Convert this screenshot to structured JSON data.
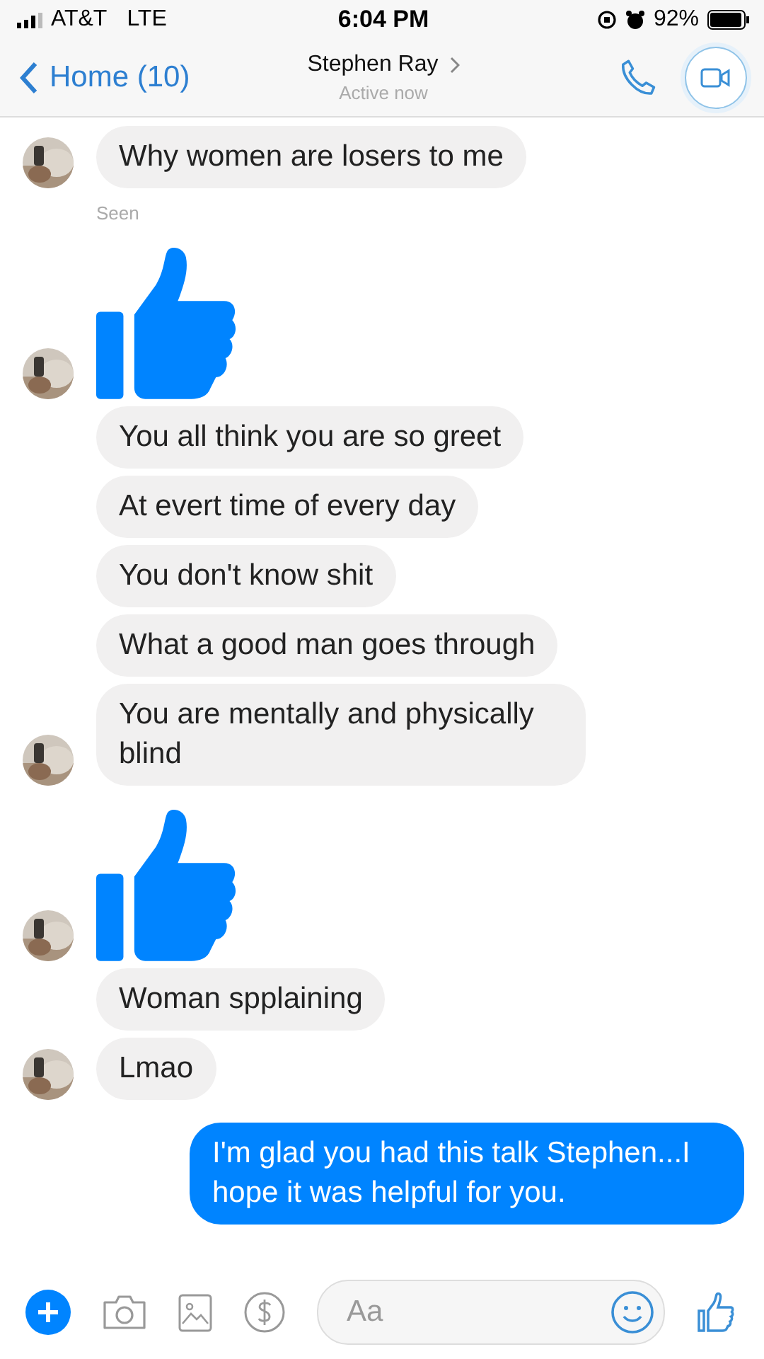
{
  "status_bar": {
    "carrier": "AT&T",
    "network": "LTE",
    "time": "6:04 PM",
    "battery": "92%"
  },
  "header": {
    "back_label": "Home (10)",
    "contact_name": "Stephen Ray",
    "presence": "Active now"
  },
  "messages": [
    {
      "kind": "received",
      "text": "Why women are losers to me",
      "avatar": true
    },
    {
      "kind": "seen",
      "text": "Seen"
    },
    {
      "kind": "like",
      "avatar": true
    },
    {
      "kind": "received",
      "text": "You all think you are so greet",
      "avatar": false
    },
    {
      "kind": "received",
      "text": "At evert time of every day",
      "avatar": false
    },
    {
      "kind": "received",
      "text": "You don't know shit",
      "avatar": false
    },
    {
      "kind": "received",
      "text": "What a good man goes through",
      "avatar": false
    },
    {
      "kind": "received",
      "text": "You are mentally and physically blind",
      "avatar": true
    },
    {
      "kind": "like",
      "avatar": true
    },
    {
      "kind": "received",
      "text": "Woman spplaining",
      "avatar": false
    },
    {
      "kind": "received",
      "text": "Lmao",
      "avatar": true
    },
    {
      "kind": "sent",
      "text": "I'm glad you had this talk Stephen...I hope it was helpful for you."
    }
  ],
  "composer": {
    "placeholder": "Aa"
  }
}
